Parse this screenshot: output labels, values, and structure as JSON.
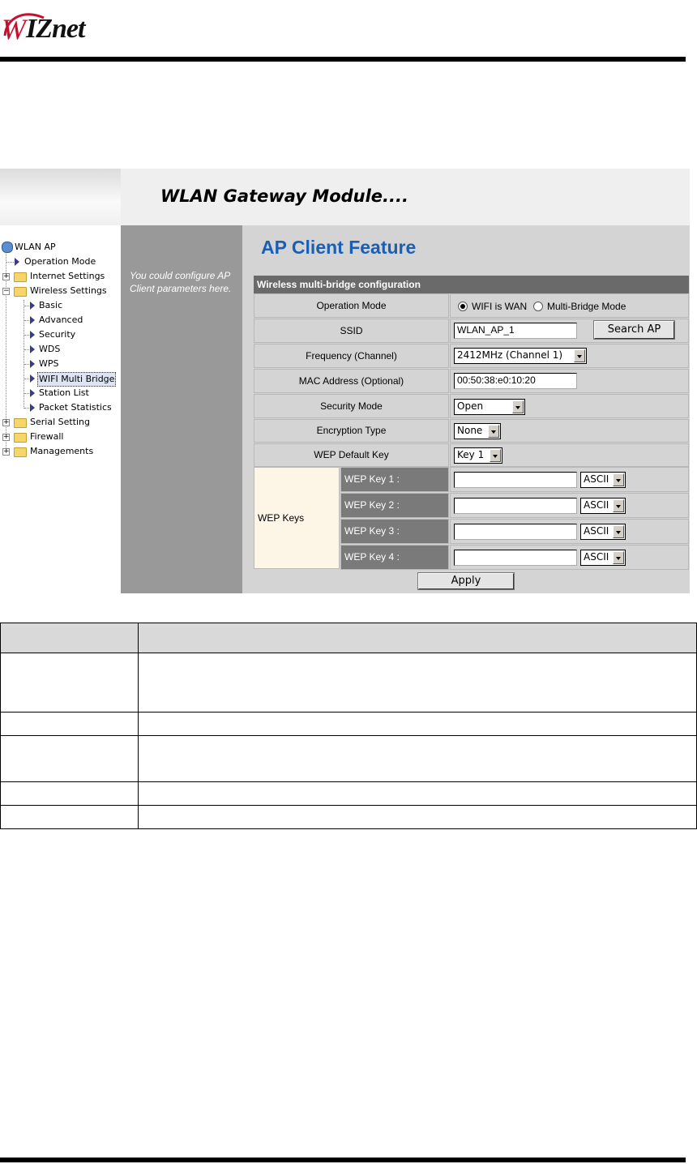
{
  "logo": {
    "text": "WIZnet"
  },
  "banner": {
    "title": "WLAN Gateway Module...."
  },
  "nav": {
    "root": "WLAN AP",
    "operation_mode": "Operation Mode",
    "internet_settings": "Internet Settings",
    "wireless_settings": "Wireless Settings",
    "wireless_children": [
      "Basic",
      "Advanced",
      "Security",
      "WDS",
      "WPS",
      "WIFI Multi Bridge",
      "Station List",
      "Packet Statistics"
    ],
    "serial_setting": "Serial Setting",
    "firewall": "Firewall",
    "managements": "Managements"
  },
  "side_description": "You could configure AP Client parameters here.",
  "page": {
    "heading": "AP Client Feature",
    "section_header": "Wireless multi-bridge configuration",
    "operation_mode": {
      "label": "Operation Mode",
      "option_wan": "WIFI is WAN",
      "option_bridge": "Multi-Bridge Mode",
      "selected": "WIFI is WAN"
    },
    "ssid": {
      "label": "SSID",
      "value": "WLAN_AP_1",
      "button": "Search AP"
    },
    "frequency": {
      "label": "Frequency (Channel)",
      "value": "2412MHz (Channel 1)"
    },
    "mac": {
      "label": "MAC Address (Optional)",
      "value": "00:50:38:e0:10:20"
    },
    "security_mode": {
      "label": "Security Mode",
      "value": "Open"
    },
    "encryption": {
      "label": "Encryption Type",
      "value": "None"
    },
    "wep_default": {
      "label": "WEP Default Key",
      "value": "Key 1"
    },
    "wep_keys": {
      "label": "WEP Keys",
      "keys": [
        {
          "label": "WEP Key 1 :",
          "value": "",
          "format": "ASCII"
        },
        {
          "label": "WEP Key 2 :",
          "value": "",
          "format": "ASCII"
        },
        {
          "label": "WEP Key 3 :",
          "value": "",
          "format": "ASCII"
        },
        {
          "label": "WEP Key 4 :",
          "value": "",
          "format": "ASCII"
        }
      ]
    },
    "apply": "Apply"
  }
}
